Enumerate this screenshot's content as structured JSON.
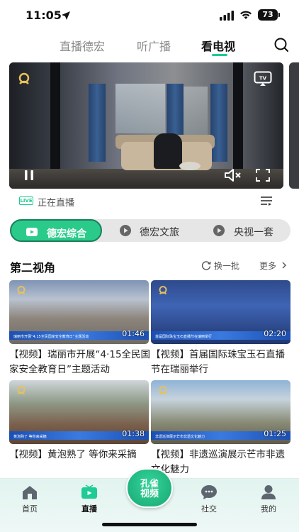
{
  "status_bar": {
    "time": "11:05",
    "battery": "73"
  },
  "top_tabs": [
    {
      "label": "直播德宏",
      "active": false
    },
    {
      "label": "听广播",
      "active": false
    },
    {
      "label": "看电视",
      "active": true
    }
  ],
  "live": {
    "badge": "LIVE",
    "status": "正在直播"
  },
  "channels": [
    {
      "label": "德宏综合",
      "active": true
    },
    {
      "label": "德宏文旅",
      "active": false
    },
    {
      "label": "央视一套",
      "active": false
    }
  ],
  "section": {
    "title": "第二视角",
    "refresh": "换一批",
    "more": "更多"
  },
  "videos": [
    {
      "title": "【视频】瑞丽市开展“4·15全民国家安全教育日”主题活动",
      "duration": "01:46",
      "caption": "瑞丽市开展“4.15全民国家安全教育日”主题活动"
    },
    {
      "title": "【视频】首届国际珠宝玉石直播节在瑞丽举行",
      "duration": "02:20",
      "caption": "首届国际珠宝玉石直播节在瑞丽举行"
    },
    {
      "title": "【视频】黄泡熟了 等你来采摘",
      "duration": "01:38",
      "caption": "黄泡熟了 等你来采摘"
    },
    {
      "title": "【视频】非遗巡演展示芒市非遗文化魅力",
      "duration": "01:25",
      "caption": "非遗巡演展示芒市非遗文化魅力"
    }
  ],
  "bottom_nav": [
    {
      "label": "首页",
      "active": false
    },
    {
      "label": "直播",
      "active": true
    },
    {
      "label": "社交",
      "active": false
    },
    {
      "label": "我的",
      "active": false
    }
  ],
  "center_button": {
    "label_top": "孔雀",
    "label_bottom": "视频"
  },
  "colors": {
    "accent": "#1ecb95",
    "channel_active": "#2acb8a"
  }
}
